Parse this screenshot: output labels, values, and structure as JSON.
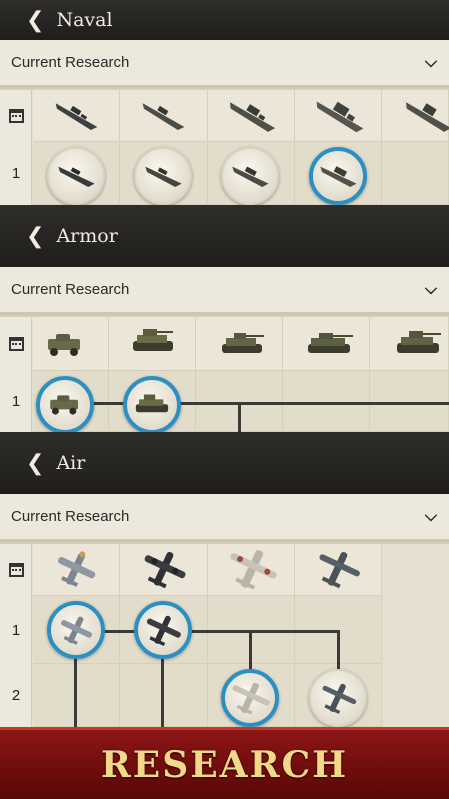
{
  "sections": [
    {
      "id": "naval",
      "title": "Naval",
      "dropdown": "Current Research",
      "rows": [
        "1"
      ]
    },
    {
      "id": "armor",
      "title": "Armor",
      "dropdown": "Current Research",
      "rows": [
        "1"
      ]
    },
    {
      "id": "air",
      "title": "Air",
      "dropdown": "Current Research",
      "rows": [
        "1",
        "2"
      ]
    }
  ],
  "icons": {
    "back": "chevron-left-icon",
    "expand": "chevron-down-icon",
    "calendar": "calendar-icon"
  },
  "colors": {
    "header_bg": "#1f1e1c",
    "active_ring": "#2b8fc2",
    "research_bg": "#7a1010",
    "research_text": "#f1d98a"
  },
  "research_button": "RESEARCH"
}
